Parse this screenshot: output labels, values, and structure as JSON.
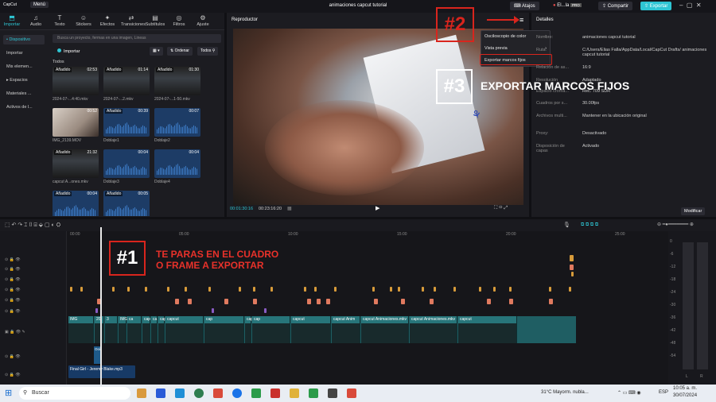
{
  "titlebar": {
    "logo": "CapCut",
    "menu": "Menú",
    "title": "animaciones capcut tutorial",
    "shortcuts": "Atajos",
    "user": "El...la",
    "pro": "PRO",
    "share": "Compartir",
    "export": "Exportar"
  },
  "tabs": [
    {
      "label": "Importar",
      "icon": "import-icon"
    },
    {
      "label": "Audio",
      "icon": "audio-icon"
    },
    {
      "label": "Texto",
      "icon": "text-icon"
    },
    {
      "label": "Stickers",
      "icon": "sticker-icon"
    },
    {
      "label": "Efectos",
      "icon": "effects-icon"
    },
    {
      "label": "Transiciones",
      "icon": "transitions-icon"
    },
    {
      "label": "Subtítulos",
      "icon": "subtitles-icon"
    },
    {
      "label": "Filtros",
      "icon": "filters-icon"
    },
    {
      "label": "Ajuste",
      "icon": "adjust-icon"
    }
  ],
  "sidenav": [
    "• Dispositivo",
    "Importar",
    "Mis elemen...",
    "▸ Espacios",
    "Materiales ...",
    "Activos de l..."
  ],
  "media": {
    "search_placeholder": "Busca un proyecto, fermas en una imagen, Lineas",
    "import": "Importar",
    "sort": "Ordenar",
    "all": "Todos",
    "section": "Todos",
    "items": [
      {
        "kind": "vid",
        "badge": "Añadido",
        "dur": "02:53",
        "name": "2024-07-...4:40.mkv"
      },
      {
        "kind": "vid",
        "badge": "Añadido",
        "dur": "01:14",
        "name": "2024-07-...2.mkv"
      },
      {
        "kind": "vid",
        "badge": "Añadido",
        "dur": "01:30",
        "name": "2024-07-...1-50.mkv"
      },
      {
        "kind": "photo",
        "badge": "",
        "dur": "00:52",
        "name": "IMG_2139.MOV"
      },
      {
        "kind": "aud",
        "badge": "Añadido",
        "dur": "00:39",
        "name": "Doblaje1"
      },
      {
        "kind": "aud",
        "badge": "",
        "dur": "00:07",
        "name": "Doblaje2"
      },
      {
        "kind": "vid",
        "badge": "Añadido",
        "dur": "21:32",
        "name": "capcut A...ones.mkv"
      },
      {
        "kind": "aud",
        "badge": "",
        "dur": "00:04",
        "name": "Doblaje3"
      },
      {
        "kind": "aud",
        "badge": "",
        "dur": "00:04",
        "name": "Doblaje4"
      },
      {
        "kind": "aud",
        "badge": "Añadido",
        "dur": "00:04",
        "name": ""
      },
      {
        "kind": "aud",
        "badge": "Añadido",
        "dur": "00:05",
        "name": ""
      }
    ]
  },
  "player": {
    "header": "Reproductor",
    "current_time": "00:01:30:16",
    "total_time": "00:23:16:20"
  },
  "context_menu": [
    {
      "label": "Osciloscopio de color",
      "arrow": "›"
    },
    {
      "label": "Vista previa",
      "arrow": "›"
    },
    {
      "label": "Exportar marcos fijos",
      "arrow": ""
    }
  ],
  "details": {
    "header": "Detalles",
    "rows": [
      {
        "k": "Nombre:",
        "v": "animaciones capcut tutorial"
      },
      {
        "k": "Ruta:",
        "v": "C:/Users/Elias Falla/AppData/Local/CapCut Drafts/ animaciones capcut tutorial"
      },
      {
        "k": "Relación de as...",
        "v": "16:9"
      },
      {
        "k": "Resolución",
        "v": "Adaptado"
      },
      {
        "k": "Espacio cromá...",
        "v": "Rec. 709 SDR"
      },
      {
        "k": "Cuadros por s...",
        "v": "30.00fps"
      },
      {
        "k": "Archivos multi...",
        "v": "Mantener en la ubicación original"
      },
      {
        "k": "Proxy:",
        "v": "Desactivado"
      },
      {
        "k": "Disposición de capas",
        "v": "Activado"
      }
    ],
    "modify": "Modificar"
  },
  "timeline": {
    "ruler": [
      "00:00",
      "05:00",
      "10:00",
      "15:00",
      "20:00",
      "25:00"
    ],
    "video_clips": [
      "IMG",
      "20",
      "3",
      "IMG",
      "ca",
      "cap",
      "ca",
      "capcut",
      "capcut",
      "cap",
      "capcut",
      "cap",
      "capcut",
      "capcut Anim",
      "capcut Animaciones.mkv",
      "capcut Animaciones.mkv",
      "capcut"
    ],
    "overlay_clip": "Ooi",
    "audio_clip": "Final Girl - Jeremy Blake.mp3"
  },
  "meter_labels": [
    "0",
    "-6",
    "-12",
    "-18",
    "-24",
    "-30",
    "-36",
    "-42",
    "-48",
    "-54"
  ],
  "meter_lr": [
    "L",
    "R"
  ],
  "annotations": {
    "step1": "#1",
    "step1_text": "TE PARAS EN EL CUADRO\nO FRAME A EXPORTAR",
    "step2": "#2",
    "step3": "#3",
    "step3_text": "EXPORTAR MARCOS FIJOS"
  },
  "taskbar": {
    "search": "Buscar",
    "weather": "31°C  Mayorm. nubla...",
    "lang": "ESP",
    "time": "10:05 a. m.",
    "date": "30/07/2024"
  },
  "colors": {
    "accent": "#2ec5d3",
    "annotation": "#d9251d",
    "video_track": "#1f5e63",
    "audio_track": "#173a66"
  }
}
